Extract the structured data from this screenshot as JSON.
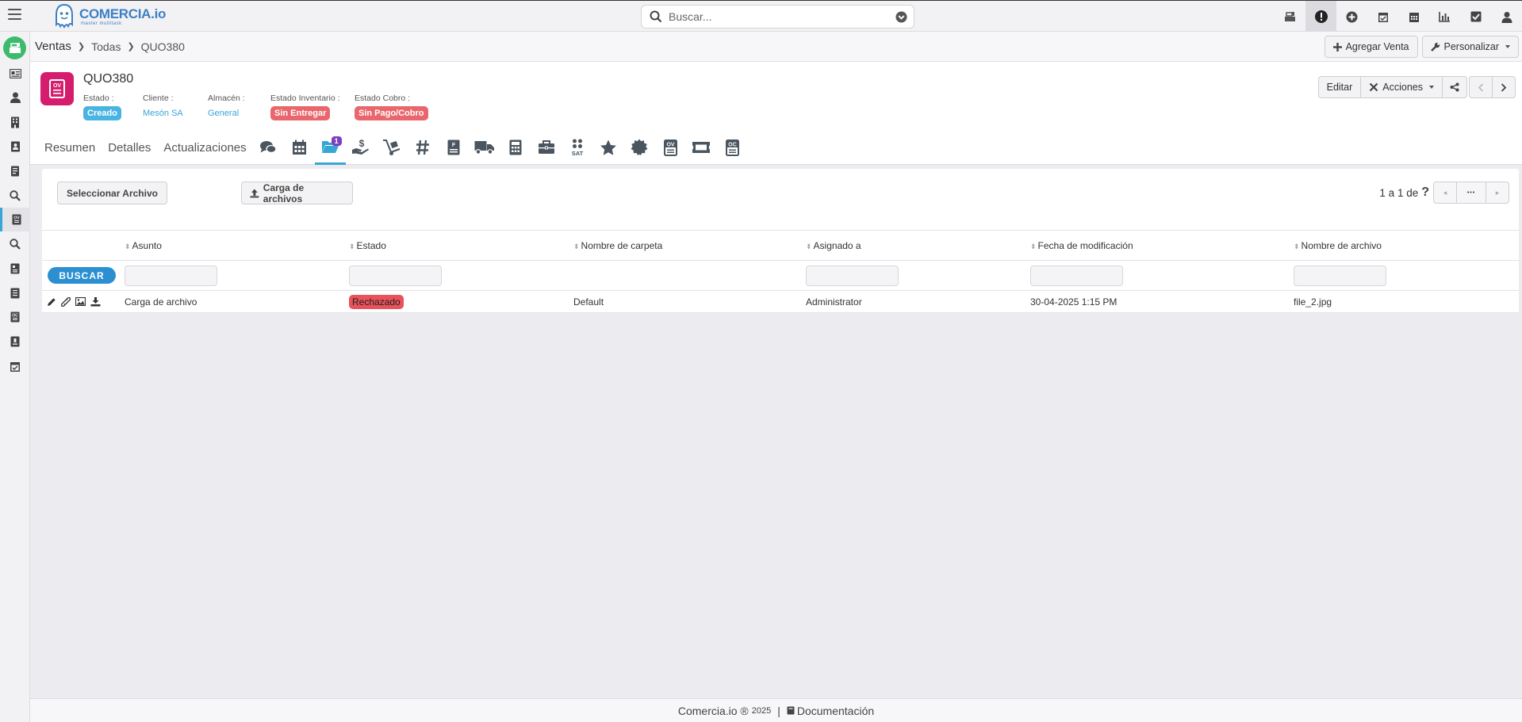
{
  "app": {
    "logo_main": "COMERCIA.io",
    "logo_sub": "master multitask"
  },
  "search": {
    "placeholder": "Buscar..."
  },
  "top_icons": [
    "cash-register-icon",
    "alert-icon",
    "plus-circle-icon",
    "calendar-check-icon",
    "calendar-icon",
    "bar-chart-icon",
    "checkbox-icon",
    "user-icon"
  ],
  "breadcrumb": {
    "level1": "Ventas",
    "level2": "Todas",
    "level3": "QUO380"
  },
  "crumb_buttons": {
    "add_sale": "Agregar Venta",
    "customize": "Personalizar"
  },
  "record": {
    "title": "QUO380",
    "icon_label": "OV",
    "fields": {
      "estado_label": "Estado :",
      "estado_value": "Creado",
      "cliente_label": "Cliente :",
      "cliente_value": "Mesón SA",
      "almacen_label": "Almacén :",
      "almacen_value": "General",
      "inventario_label": "Estado Inventario :",
      "inventario_value": "Sin Entregar",
      "cobro_label": "Estado Cobro :",
      "cobro_value": "Sin Pago/Cobro"
    },
    "actions": {
      "edit": "Editar",
      "actions": "Acciones"
    }
  },
  "tabs": {
    "resumen": "Resumen",
    "detalles": "Detalles",
    "actualizaciones": "Actualizaciones",
    "files_count": "1"
  },
  "files": {
    "select_file": "Seleccionar Archivo",
    "upload": "Carga de archivos",
    "pager_text": "1 a 1  de",
    "pager_unknown": "?",
    "pager_dots": "•••",
    "search_button": "BUSCAR",
    "columns": [
      "Asunto",
      "Estado",
      "Nombre de carpeta",
      "Asignado a",
      "Fecha de modificación",
      "Nombre de archivo"
    ],
    "rows": [
      {
        "asunto": "Carga de archivo",
        "estado": "Rechazado",
        "carpeta": "Default",
        "asignado": "Administrator",
        "fecha": "30-04-2025 1:15 PM",
        "archivo": "file_2.jpg"
      }
    ]
  },
  "footer": {
    "brand": "Comercia.io ®",
    "year": "2025",
    "pipe": "|",
    "docs": "Documentación"
  },
  "colors": {
    "accent": "#37a6d6",
    "brand": "#3c7fc4",
    "record_icon": "#d61d6d",
    "home": "#3dbb6c",
    "badge_blue": "#49b4e2",
    "badge_red": "#e9676c",
    "count_badge": "#7e3fbf",
    "buscar": "#2c8fd1"
  }
}
